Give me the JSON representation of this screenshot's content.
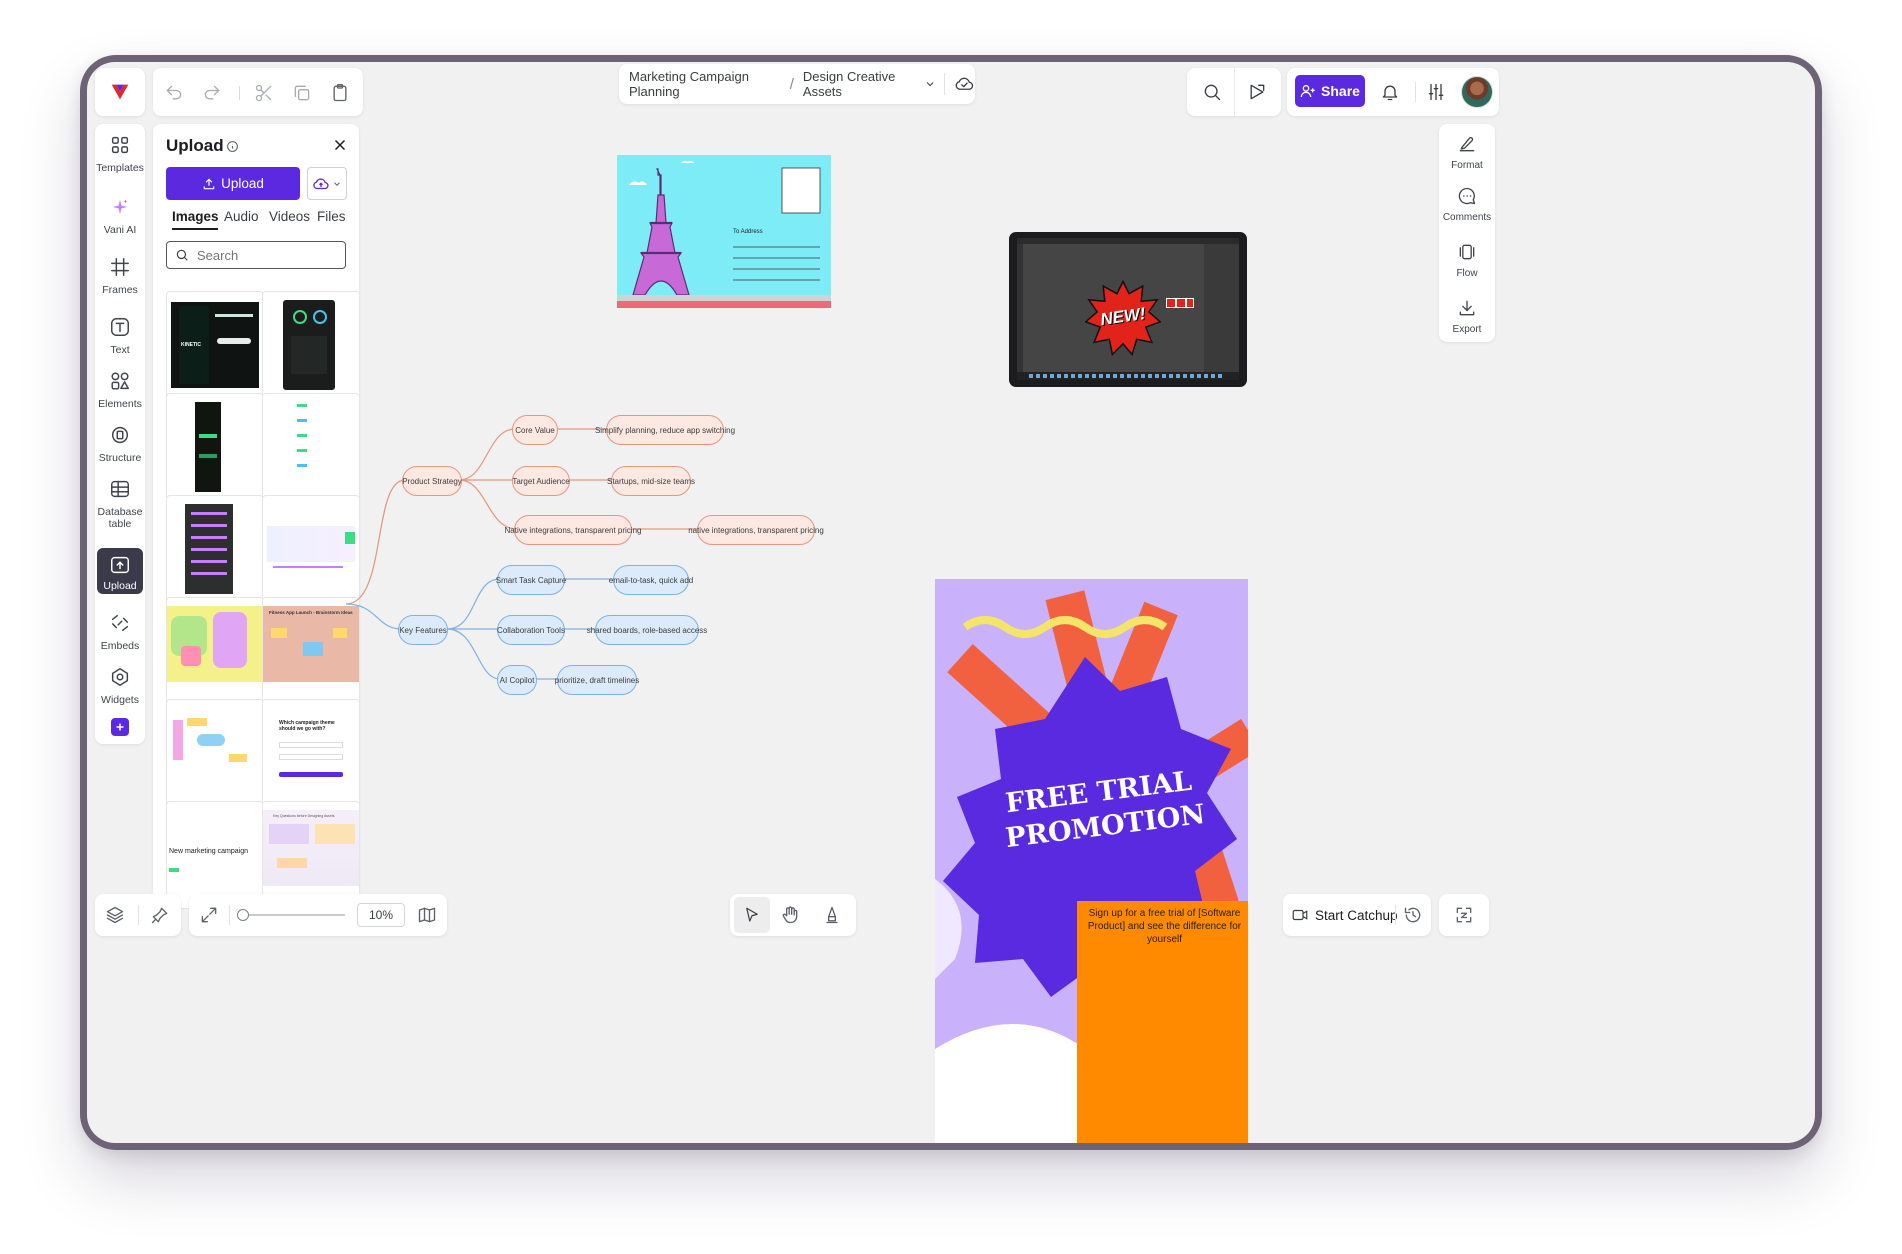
{
  "breadcrumb": {
    "project": "Marketing Campaign Planning",
    "separator": "/",
    "board": "Design Creative Assets"
  },
  "header": {
    "share_label": "Share",
    "accent_color": "#5b2ae0"
  },
  "left_rail": {
    "items": [
      {
        "label": "Templates",
        "icon": "templates-icon"
      },
      {
        "label": "Vani AI",
        "icon": "sparkle-icon"
      },
      {
        "label": "Frames",
        "icon": "frame-icon"
      },
      {
        "label": "Text",
        "icon": "text-icon"
      },
      {
        "label": "Elements",
        "icon": "elements-icon"
      },
      {
        "label": "Structure",
        "icon": "structure-icon"
      },
      {
        "label": "Database table",
        "icon": "table-icon"
      },
      {
        "label": "Upload",
        "icon": "upload-icon",
        "active": true
      },
      {
        "label": "Embeds",
        "icon": "embed-icon"
      },
      {
        "label": "Widgets",
        "icon": "widgets-icon"
      }
    ]
  },
  "upload_panel": {
    "title": "Upload",
    "upload_button": "Upload",
    "tabs": [
      "Images",
      "Audio",
      "Videos",
      "Files"
    ],
    "active_tab": "Images",
    "search_placeholder": "Search",
    "thumbs": [
      {
        "kind": "dark-phone",
        "text": "KINETIC"
      },
      {
        "kind": "dark-phone-2",
        "text": ""
      },
      {
        "kind": "dark-tall",
        "text": ""
      },
      {
        "kind": "light-list",
        "text": ""
      },
      {
        "kind": "dark-grid",
        "text": ""
      },
      {
        "kind": "light-flow",
        "text": ""
      },
      {
        "kind": "colorful-board",
        "text": ""
      },
      {
        "kind": "brainstorm",
        "text": "Fitness App Launch - Brainstorm Ideas"
      },
      {
        "kind": "mindmap",
        "text": ""
      },
      {
        "kind": "poll",
        "text": "Which campaign theme should we go with?"
      },
      {
        "kind": "campaign",
        "text": "New marketing campaign"
      },
      {
        "kind": "questions",
        "text": "Key Questions before Designing Assets"
      }
    ]
  },
  "zoom": {
    "value": "10%",
    "level": 0.05
  },
  "right_rail": {
    "items": [
      {
        "label": "Format",
        "icon": "format-icon"
      },
      {
        "label": "Comments",
        "icon": "comments-icon"
      },
      {
        "label": "Flow",
        "icon": "flow-icon"
      },
      {
        "label": "Export",
        "icon": "export-icon"
      }
    ]
  },
  "bottom_right": {
    "catchup_label": "Start Catchup"
  },
  "canvas": {
    "postcard": {
      "to_address": "To Address"
    },
    "mindmap": {
      "product_strategy": "Product Strategy",
      "key_features": "Key Features",
      "core_value": "Core Value",
      "core_value_detail": "Simplify planning, reduce app switching",
      "target_audience": "Target Audience",
      "target_audience_detail": "Startups, mid-size teams",
      "native": "Native integrations, transparent pricing",
      "native_detail": "native integrations, transparent pricing",
      "smart_task": "Smart Task Capture",
      "smart_task_detail": "email-to-task, quick add",
      "collab": "Collaboration Tools",
      "collab_detail": "shared boards, role-based access",
      "ai": "AI Copilot",
      "ai_detail": "prioritize, draft timelines"
    },
    "editor_screenshot": {
      "badge": "NEW!"
    },
    "promo": {
      "line1": "FREE TRIAL",
      "line2": "PROMOTION",
      "cta": "Sign up for a free trial of [Software Product] and see the difference for yourself"
    }
  }
}
